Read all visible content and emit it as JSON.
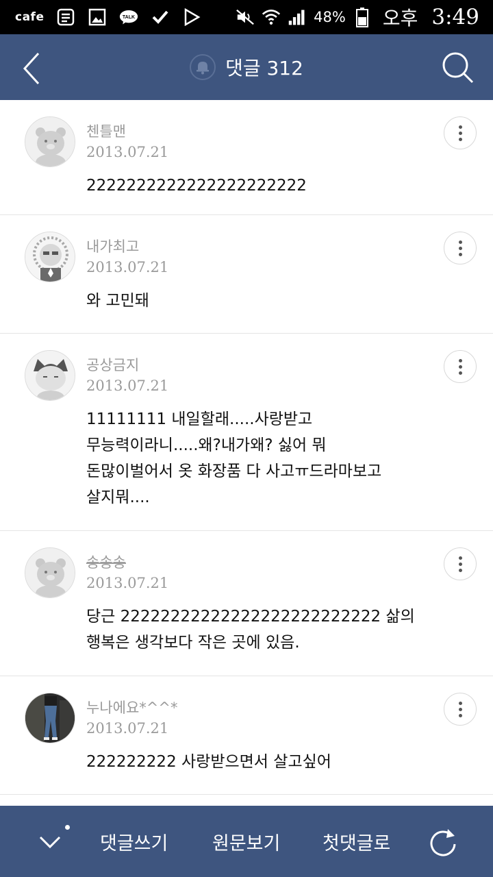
{
  "status_bar": {
    "cafe": "cafe",
    "battery": "48%",
    "ampm": "오후",
    "time": "3:49"
  },
  "header": {
    "title": "댓글 312",
    "icons": [
      "back-arrow-icon",
      "bell-icon",
      "search-icon"
    ]
  },
  "comments": [
    {
      "author": "첸틀맨",
      "date": "2013.07.21",
      "text": "2222222222222222222222",
      "strike": false
    },
    {
      "author": "내가최고",
      "date": "2013.07.21",
      "text": "와 고민돼",
      "strike": false
    },
    {
      "author": "공상금지",
      "date": "2013.07.21",
      "text": "11111111 내일할래.....사랑받고\n무능력이라니.....왜?내가왜? 싫어 뭐\n돈많이벌어서 옷 화장품 다 사고ㅠ드라마보고\n살지뭐....",
      "strike": false
    },
    {
      "author": "송송송",
      "date": "2013.07.21",
      "text": "당근 22222222222222222222222222 삶의\n행복은 생각보다 작은 곳에 있음.",
      "strike": true
    },
    {
      "author": "누나에요*^^*",
      "date": "2013.07.21",
      "text": "222222222 사랑받으면서 살고싶어",
      "strike": false
    }
  ],
  "bottom_bar": {
    "write": "댓글쓰기",
    "original": "원문보기",
    "first": "첫댓글로"
  },
  "colors": {
    "header_bg": "#3e557f",
    "meta_text": "#9a9a9a"
  }
}
